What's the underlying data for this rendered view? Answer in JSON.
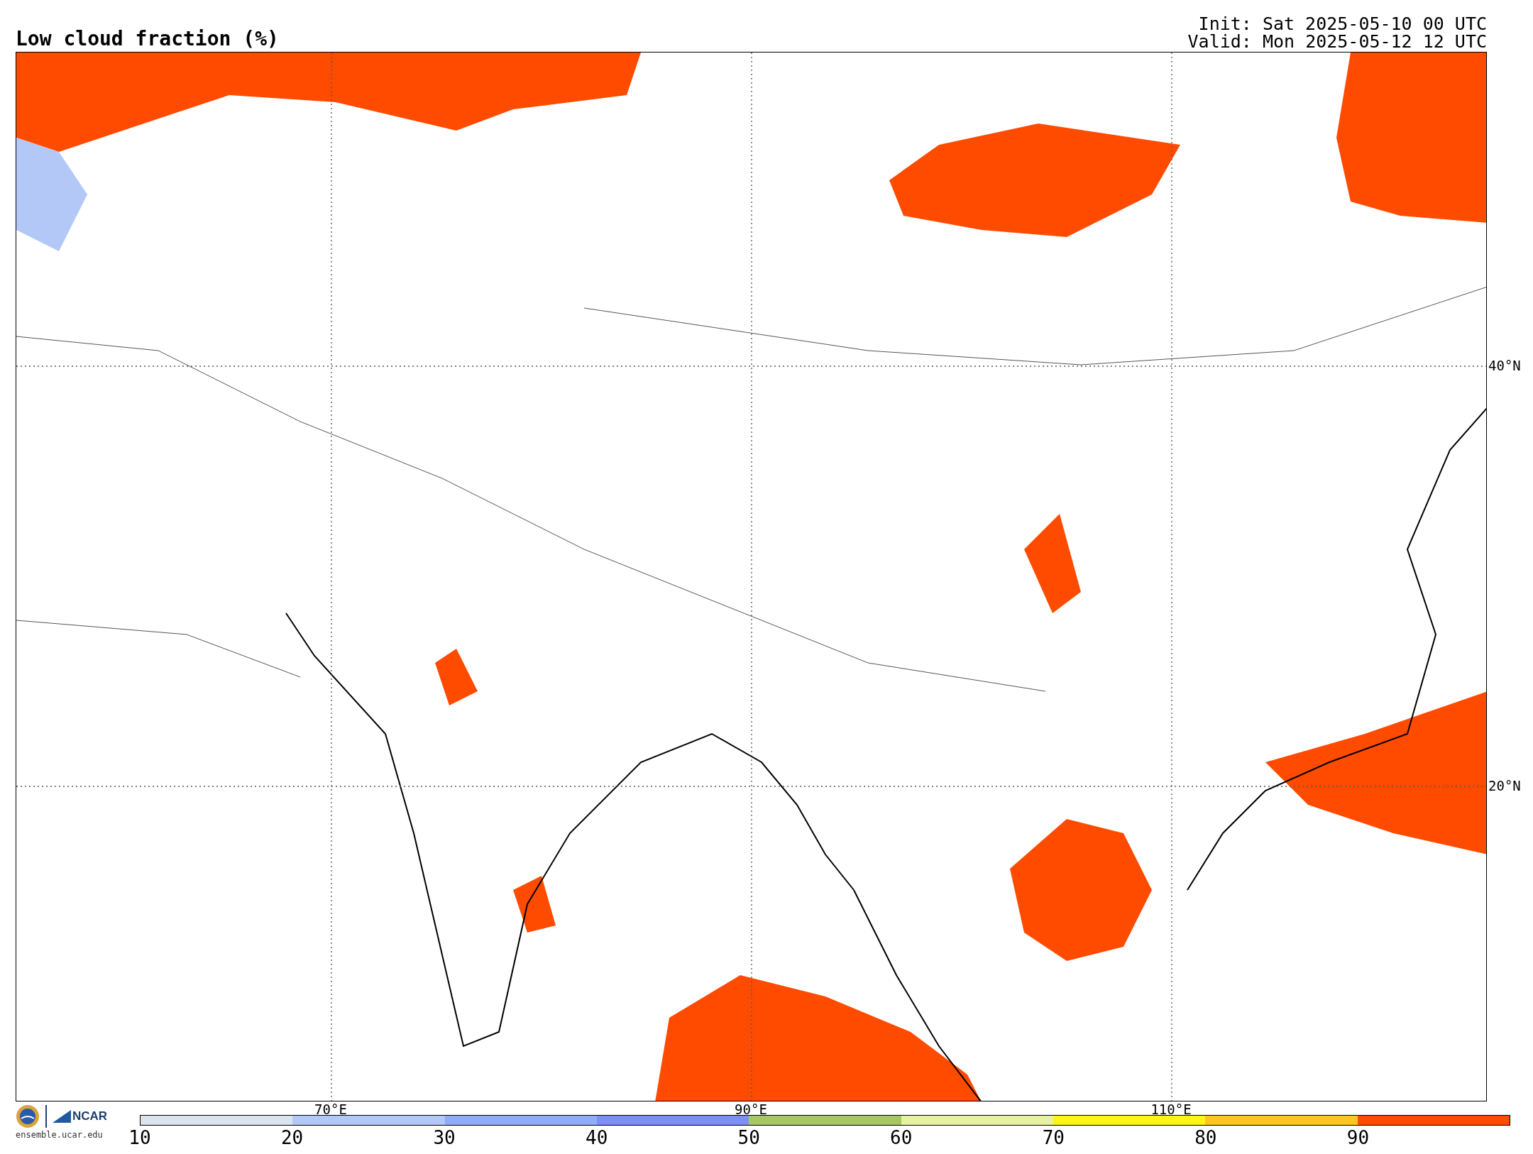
{
  "title": "Low cloud fraction (%)",
  "init": "Init: Sat 2025-05-10 00 UTC",
  "valid": "Valid: Mon 2025-05-12 12 UTC",
  "map": {
    "lat_labels": [
      "40°N",
      "20°N"
    ],
    "lon_labels": [
      "70°E",
      "90°E",
      "110°E"
    ]
  },
  "logos": {
    "ncar": "NCAR",
    "site": "ensemble.ucar.edu"
  },
  "colorbar": {
    "segments": [
      {
        "color": "#d9e4ef"
      },
      {
        "color": "#b4c8f7"
      },
      {
        "color": "#8fadf7"
      },
      {
        "color": "#7d8ff5"
      },
      {
        "color": "#a5c764"
      },
      {
        "color": "#e6f2a2"
      },
      {
        "color": "#fff514"
      },
      {
        "color": "#ffc522"
      },
      {
        "color": "#ff4b00"
      }
    ],
    "ticks": [
      "10",
      "20",
      "30",
      "40",
      "50",
      "60",
      "70",
      "80",
      "90"
    ]
  }
}
